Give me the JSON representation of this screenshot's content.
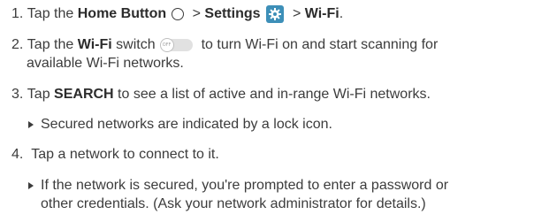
{
  "steps": [
    {
      "number": "1.",
      "text_a": "Tap the ",
      "home_label": "Home Button",
      "separator_1": " > ",
      "settings_label": "Settings",
      "separator_2": " > ",
      "wifi_label": "Wi-Fi",
      "end": "."
    },
    {
      "number": "2.",
      "text_a": "Tap the ",
      "wifi_label": "Wi-Fi",
      "text_b": " switch",
      "switch_knob_text": "OFF",
      "text_c": "to turn Wi-Fi on and start scanning for",
      "line2": "available Wi-Fi networks."
    },
    {
      "number": "3.",
      "text_a": "Tap ",
      "search_label": "SEARCH",
      "text_b": " to see a list of active and in-range Wi-Fi networks.",
      "bullet": "Secured networks are indicated by a lock icon."
    },
    {
      "number": "4.",
      "text": "Tap a network to connect to it.",
      "bullet_line1": "If the network is secured, you're prompted to enter a password or",
      "bullet_line2": "other credentials. (Ask your network administrator for details.)"
    }
  ],
  "colors": {
    "text": "#3c3c3c",
    "settings_icon_bg": "#3d8fb8",
    "switch_track": "#e1e1e1"
  },
  "icons": [
    "home-button-icon",
    "settings-gear-icon",
    "wifi-switch-icon",
    "bullet-triangle-icon"
  ]
}
